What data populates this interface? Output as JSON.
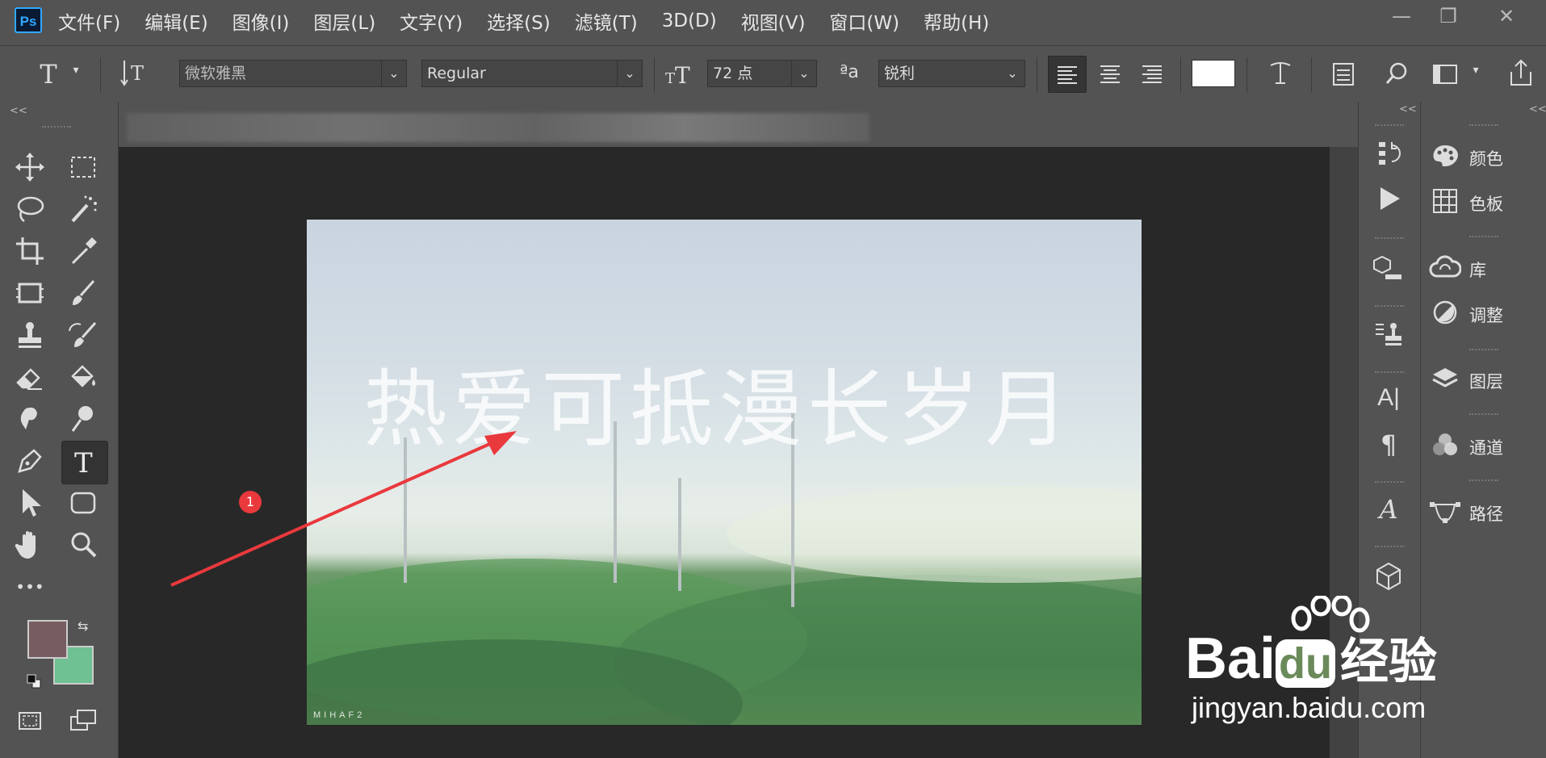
{
  "app": {
    "logo": "Ps",
    "menu": [
      "文件(F)",
      "编辑(E)",
      "图像(I)",
      "图层(L)",
      "文字(Y)",
      "选择(S)",
      "滤镜(T)",
      "3D(D)",
      "视图(V)",
      "窗口(W)",
      "帮助(H)"
    ],
    "window_controls": {
      "minimize": "—",
      "restore": "❐",
      "close": "✕"
    }
  },
  "options": {
    "font_family": "微软雅黑",
    "font_style": "Regular",
    "font_size": "72 点",
    "antialias": "锐利",
    "text_color": "#ffffff"
  },
  "panels": {
    "collapse_label": "<<",
    "right": [
      {
        "icon": "palette-icon",
        "label": "颜色"
      },
      {
        "icon": "grid-icon",
        "label": "色板"
      },
      {
        "icon": "cloud-icon",
        "label": "库"
      },
      {
        "icon": "adjust-icon",
        "label": "调整"
      },
      {
        "icon": "layers-icon",
        "label": "图层"
      },
      {
        "icon": "channels-icon",
        "label": "通道"
      },
      {
        "icon": "pen-path-icon",
        "label": "路径"
      }
    ]
  },
  "tools": {
    "foreground": "#765d62",
    "background": "#6fc092",
    "more": "•••"
  },
  "canvas": {
    "overlay_text": "热爱可抵漫长岁月",
    "signature": "MIHAF2",
    "annotation_number": "1"
  },
  "watermark": {
    "brand_a": "Bai",
    "brand_b": "du",
    "brand_c": "经验",
    "url": "jingyan.baidu.com"
  },
  "colors": {
    "ui_bg": "#535353",
    "canvas_bg": "#282828",
    "accent_blue": "#31a8ff",
    "annotation_red": "#e9393d"
  }
}
